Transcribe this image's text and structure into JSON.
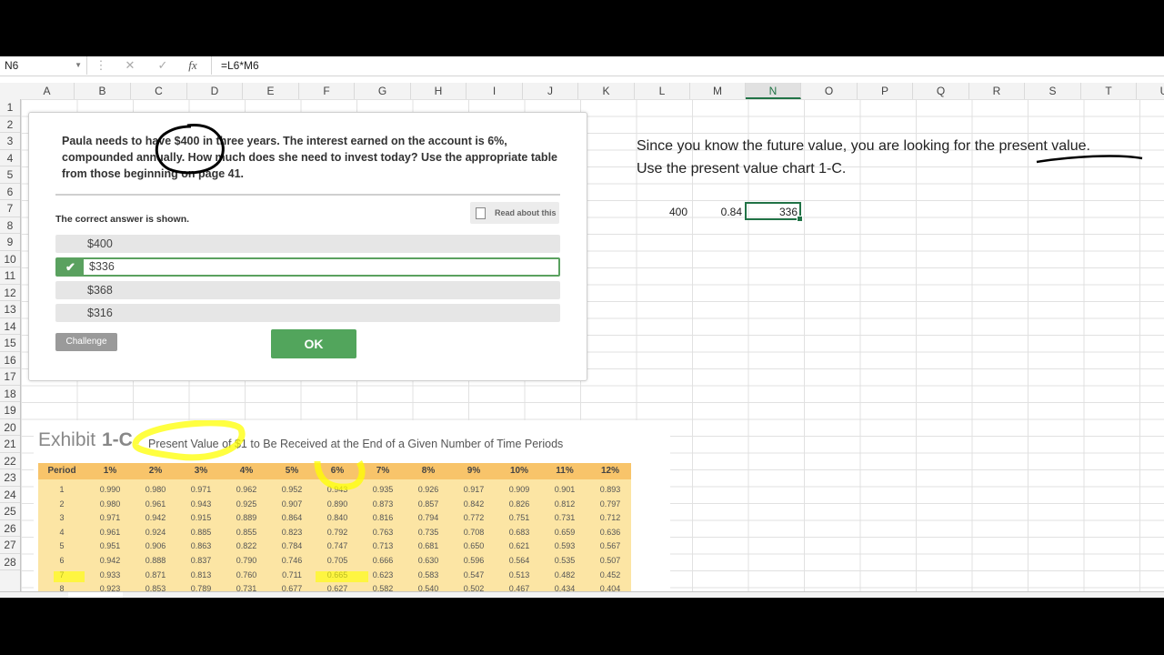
{
  "formula_bar": {
    "name_box": "N6",
    "formula": "=L6*M6",
    "icons": [
      "menu-dots-icon",
      "cancel-icon",
      "confirm-icon",
      "fx-icon"
    ]
  },
  "columns": [
    "A",
    "B",
    "C",
    "D",
    "E",
    "F",
    "G",
    "H",
    "I",
    "J",
    "K",
    "L",
    "M",
    "N",
    "O",
    "P",
    "Q",
    "R",
    "S",
    "T",
    "U"
  ],
  "selected_column": "N",
  "rows": [
    "1",
    "2",
    "3",
    "4",
    "5",
    "6",
    "7",
    "8",
    "9",
    "10",
    "11",
    "12",
    "13",
    "14",
    "15",
    "16",
    "17",
    "18",
    "19",
    "20",
    "21",
    "22",
    "23",
    "24",
    "25",
    "26",
    "27",
    "28"
  ],
  "quiz": {
    "question": "Paula needs to have $400 in three years. The interest earned on the account is 6%, compounded annually. How much does she need to invest today? Use the appropriate table from those beginning on page 41.",
    "correct_label": "The correct answer is shown.",
    "read_about": "Read about this",
    "options": [
      "$400",
      "$336",
      "$368",
      "$316"
    ],
    "selected_option": "$336",
    "challenge": "Challenge",
    "ok": "OK"
  },
  "exhibit": {
    "title": "Exhibit",
    "number": "1-C",
    "subtitle": "Present Value of $1 to Be Received at the End of a Given Number of Time Periods",
    "headers": [
      "Period",
      "1%",
      "2%",
      "3%",
      "4%",
      "5%",
      "6%",
      "7%",
      "8%",
      "9%",
      "10%",
      "11%",
      "12%"
    ],
    "rows": [
      [
        "1",
        "0.990",
        "0.980",
        "0.971",
        "0.962",
        "0.952",
        "0.943",
        "0.935",
        "0.926",
        "0.917",
        "0.909",
        "0.901",
        "0.893"
      ],
      [
        "2",
        "0.980",
        "0.961",
        "0.943",
        "0.925",
        "0.907",
        "0.890",
        "0.873",
        "0.857",
        "0.842",
        "0.826",
        "0.812",
        "0.797"
      ],
      [
        "3",
        "0.971",
        "0.942",
        "0.915",
        "0.889",
        "0.864",
        "0.840",
        "0.816",
        "0.794",
        "0.772",
        "0.751",
        "0.731",
        "0.712"
      ],
      [
        "4",
        "0.961",
        "0.924",
        "0.885",
        "0.855",
        "0.823",
        "0.792",
        "0.763",
        "0.735",
        "0.708",
        "0.683",
        "0.659",
        "0.636"
      ],
      [
        "5",
        "0.951",
        "0.906",
        "0.863",
        "0.822",
        "0.784",
        "0.747",
        "0.713",
        "0.681",
        "0.650",
        "0.621",
        "0.593",
        "0.567"
      ],
      [
        "6",
        "0.942",
        "0.888",
        "0.837",
        "0.790",
        "0.746",
        "0.705",
        "0.666",
        "0.630",
        "0.596",
        "0.564",
        "0.535",
        "0.507"
      ],
      [
        "7",
        "0.933",
        "0.871",
        "0.813",
        "0.760",
        "0.711",
        "0.665",
        "0.623",
        "0.583",
        "0.547",
        "0.513",
        "0.482",
        "0.452"
      ],
      [
        "8",
        "0.923",
        "0.853",
        "0.789",
        "0.731",
        "0.677",
        "0.627",
        "0.582",
        "0.540",
        "0.502",
        "0.467",
        "0.434",
        "0.404"
      ]
    ]
  },
  "notes": {
    "line1": "Since you know the future value, you are looking for the present value.",
    "line2": "Use the present value chart 1-C."
  },
  "cells": {
    "L6": "400",
    "M6": "0.84",
    "N6": "336"
  },
  "colors": {
    "excel_green": "#217346",
    "quiz_green": "#52a55c",
    "table_header": "#f8c46a",
    "table_body": "#fce5a4",
    "highlighter": "#ffff00"
  }
}
